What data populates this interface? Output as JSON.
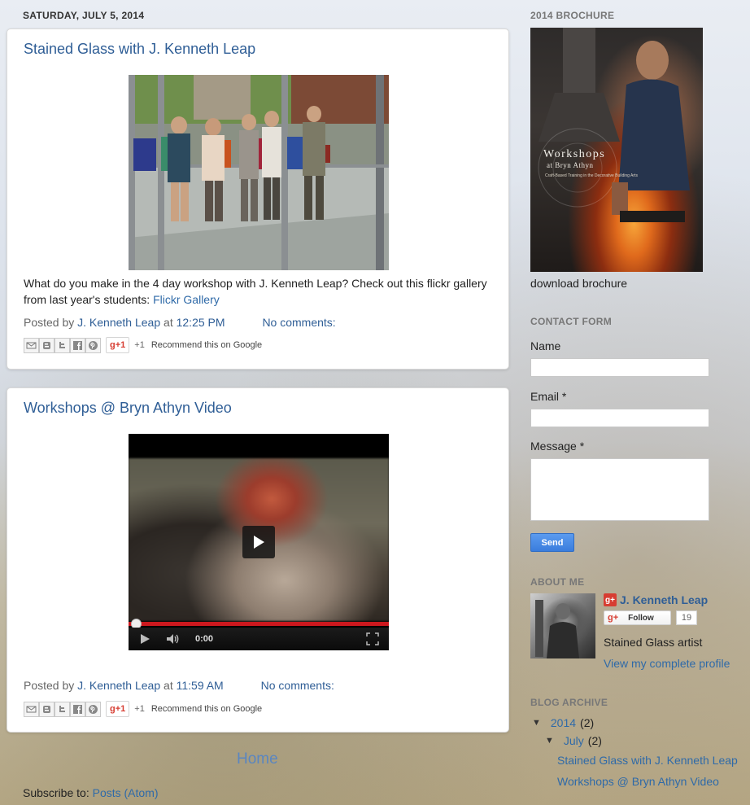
{
  "date_header": "SATURDAY, JULY 5, 2014",
  "posts": [
    {
      "title": "Stained Glass with J. Kenneth Leap",
      "body_text": "What do you make in the 4 day workshop with J. Kenneth Leap? Check out this flickr gallery from last year's students:",
      "body_link": "Flickr Gallery",
      "posted_by_label": "Posted by",
      "author": "J. Kenneth Leap",
      "at_label": "at",
      "time": "12:25 PM",
      "comments": "No comments:",
      "plus_one": "+1",
      "gplus_label": "+1",
      "recommend": "Recommend this on Google"
    },
    {
      "title": "Workshops @ Bryn Athyn Video",
      "video_time": "0:00",
      "posted_by_label": "Posted by",
      "author": "J. Kenneth Leap",
      "at_label": "at",
      "time": "11:59 AM",
      "comments": "No comments:",
      "plus_one": "+1",
      "gplus_label": "+1",
      "recommend": "Recommend this on Google"
    }
  ],
  "share_icons": [
    "email-icon",
    "blogger-icon",
    "twitter-icon",
    "facebook-icon",
    "pinterest-icon"
  ],
  "home_link": "Home",
  "subscribe": {
    "label": "Subscribe to:",
    "link": "Posts (Atom)"
  },
  "sidebar": {
    "brochure": {
      "title": "2014 BROCHURE",
      "cover_title": "Workshops",
      "cover_sub": "at Bryn Athyn",
      "cover_tag": "Craft-Based Training in the Decorative Building Arts",
      "download": "download brochure"
    },
    "contact": {
      "title": "CONTACT FORM",
      "name_label": "Name",
      "email_label": "Email *",
      "message_label": "Message *",
      "send_label": "Send"
    },
    "about": {
      "title": "ABOUT ME",
      "name": "J. Kenneth Leap",
      "follow_label": "Follow",
      "follower_count": "19",
      "description": "Stained Glass artist",
      "profile_link": "View my complete profile"
    },
    "archive": {
      "title": "BLOG ARCHIVE",
      "year": "2014",
      "year_count": "(2)",
      "month": "July",
      "month_count": "(2)",
      "posts": [
        "Stained Glass with J. Kenneth Leap",
        "Workshops @ Bryn Athyn Video"
      ]
    }
  },
  "colors": {
    "link": "#2f6aa8",
    "title": "#2f5e96",
    "send_button": "#3a7ddd",
    "video_progress": "#cc181e"
  }
}
